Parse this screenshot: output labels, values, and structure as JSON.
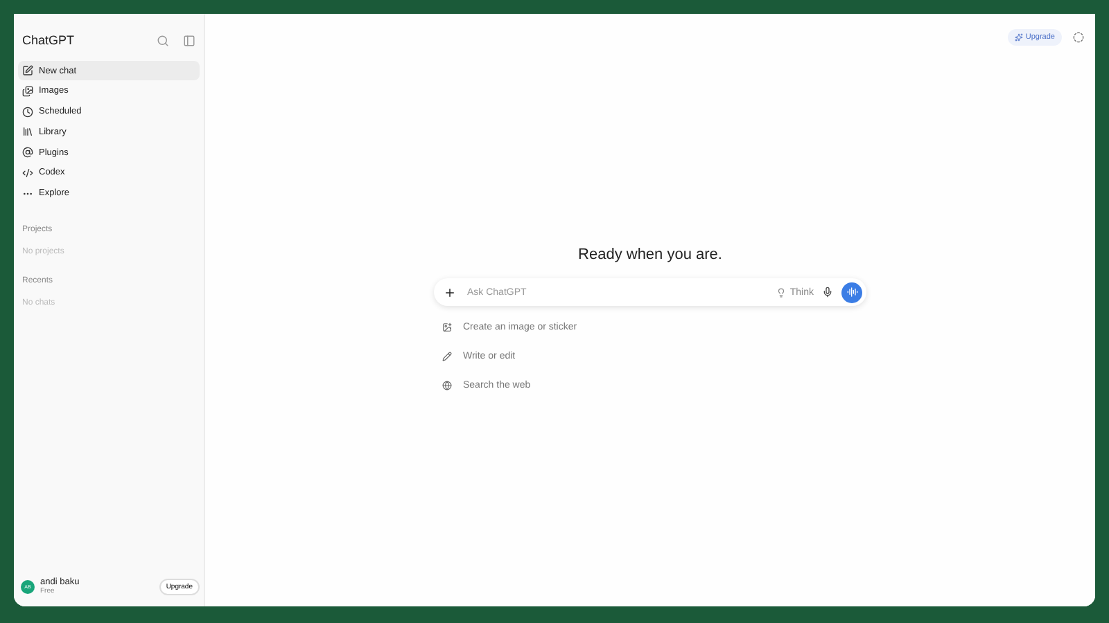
{
  "sidebar": {
    "title": "ChatGPT",
    "items": [
      {
        "kind": "new",
        "label": "New chat",
        "selected": true
      },
      {
        "kind": "images",
        "label": "Images",
        "selected": false
      },
      {
        "kind": "scheduled",
        "label": "Scheduled",
        "selected": false
      },
      {
        "kind": "library",
        "label": "Library",
        "selected": false
      },
      {
        "kind": "plugins",
        "label": "Plugins",
        "selected": false
      },
      {
        "kind": "codex",
        "label": "Codex",
        "selected": false
      },
      {
        "kind": "explore",
        "label": "Explore",
        "selected": false
      }
    ],
    "sections": [
      {
        "heading": "Projects",
        "empty": "No projects"
      },
      {
        "heading": "Recents",
        "empty": "No chats"
      }
    ],
    "user": {
      "initials": "AB",
      "name": "andi baku",
      "plan": "Free",
      "button": "Upgrade"
    }
  },
  "header": {
    "upgrade": "Upgrade"
  },
  "main": {
    "heading": "Ready when you are.",
    "placeholder": "Ask ChatGPT",
    "think": "Think",
    "suggestions": [
      {
        "kind": "image",
        "label": "Create an image or sticker"
      },
      {
        "kind": "write",
        "label": "Write or edit"
      },
      {
        "kind": "web",
        "label": "Search the web"
      }
    ]
  }
}
